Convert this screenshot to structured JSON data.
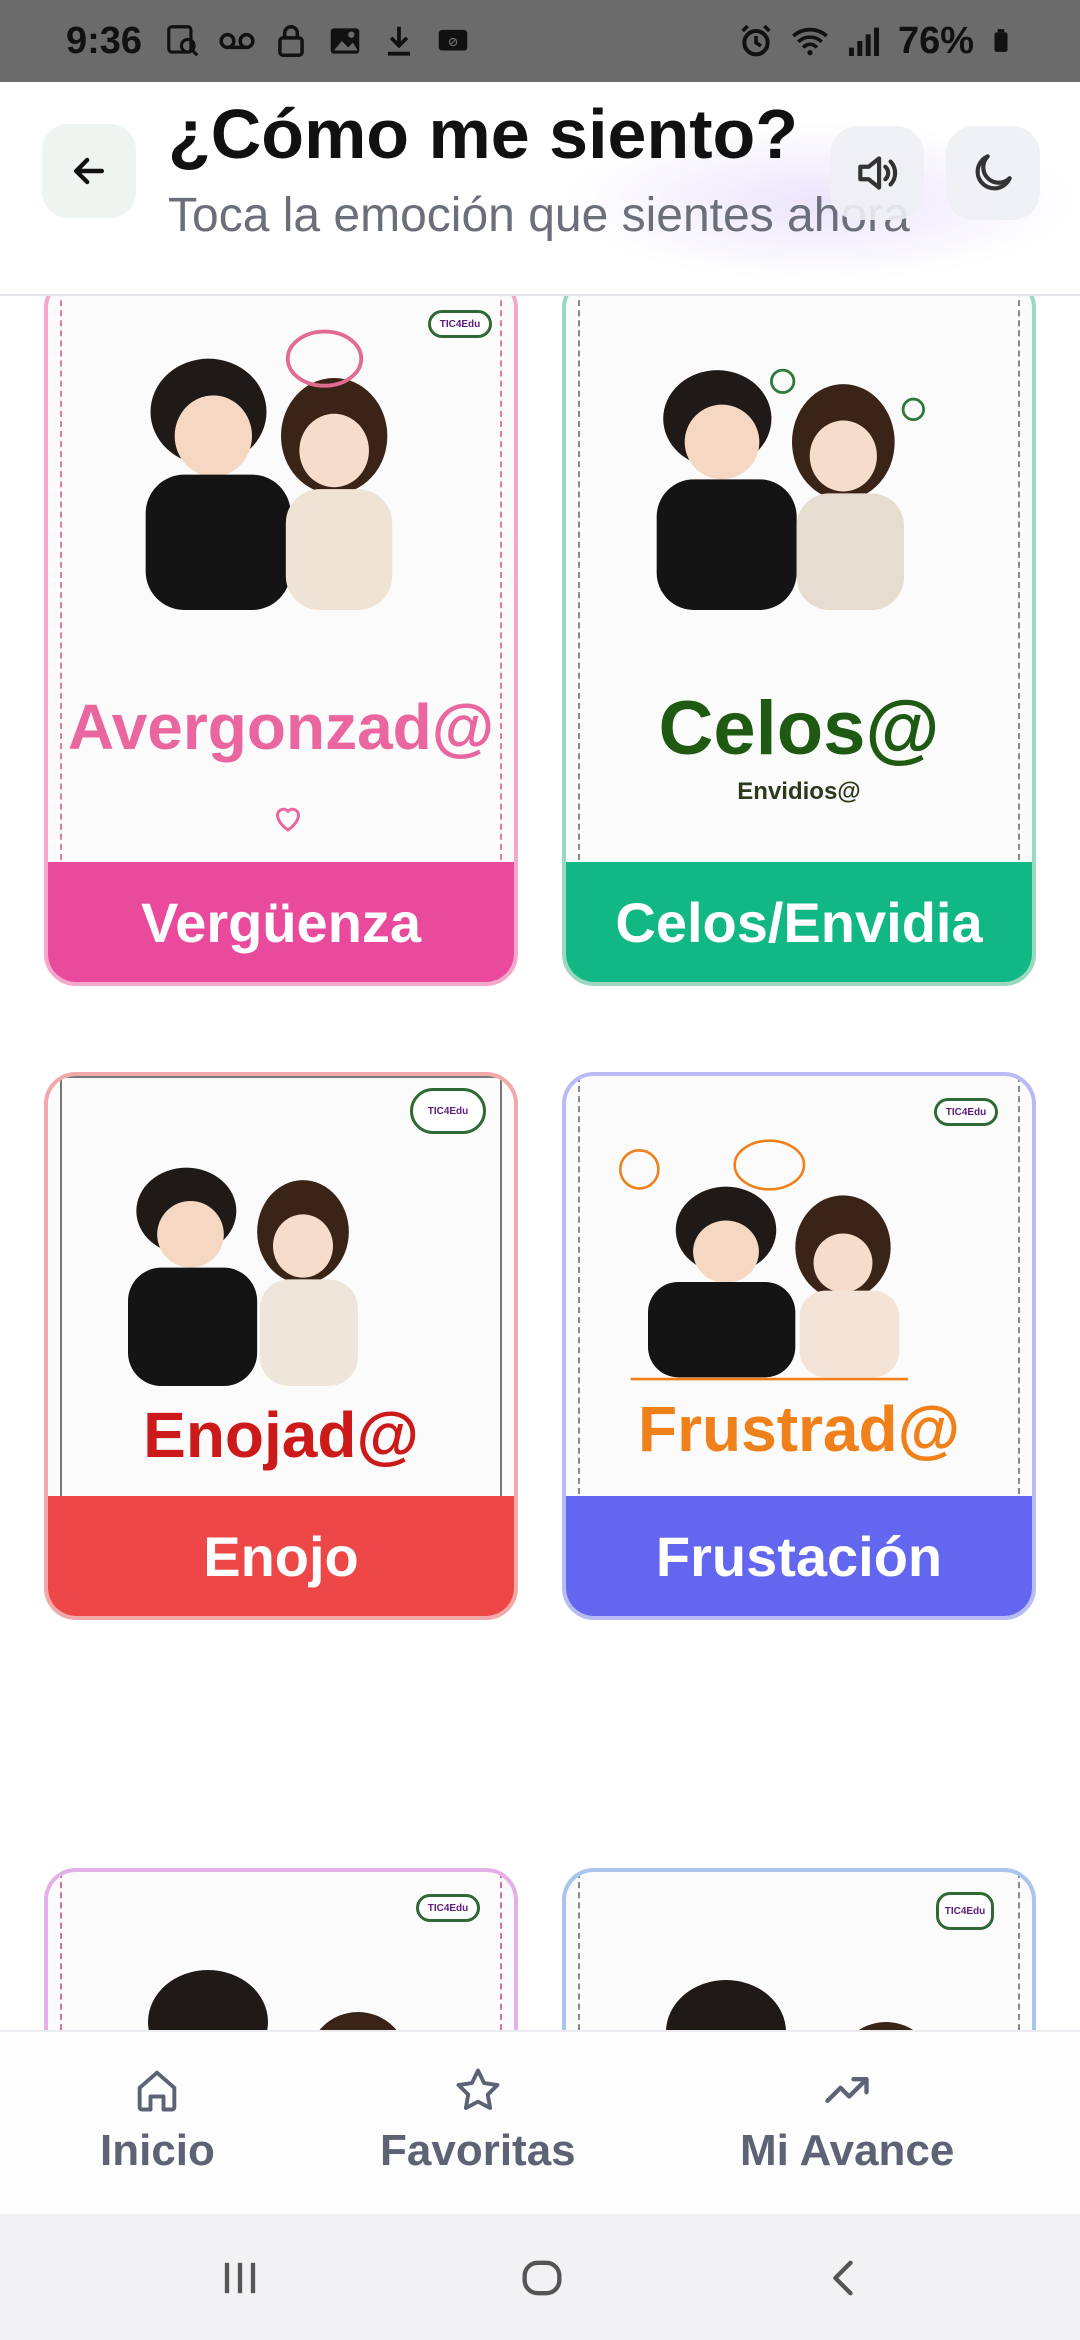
{
  "status_bar": {
    "time": "9:36",
    "battery": "76%"
  },
  "header": {
    "title": "¿Cómo me siento?",
    "subtitle": "Toca la emoción que sientes ahora"
  },
  "cards": [
    {
      "word": "Avergonzad@",
      "sub": "",
      "label": "Vergüenza",
      "label_color": "#e94a9b",
      "border_color": "#f4a8cc",
      "word_color": "#e9669f"
    },
    {
      "word": "Celos@",
      "sub": "Envidios@",
      "label": "Celos/Envidia",
      "label_color": "#12b883",
      "border_color": "#9ad8bf",
      "word_color": "#1f5a12"
    },
    {
      "word": "Enojad@",
      "sub": "",
      "label": "Enojo",
      "label_color": "#ee4747",
      "border_color": "#f2a9a9",
      "word_color": "#cc1a1a"
    },
    {
      "word": "Frustrad@",
      "sub": "",
      "label": "Frustación",
      "label_color": "#6366ee",
      "border_color": "#b9bbf6",
      "word_color": "#f08019"
    }
  ],
  "logo_text": "TIC4Edu",
  "bottom_nav": {
    "items": [
      {
        "label": "Inicio",
        "icon": "home-icon"
      },
      {
        "label": "Favoritas",
        "icon": "star-icon"
      },
      {
        "label": "Mi Avance",
        "icon": "trending-up-icon"
      }
    ]
  }
}
